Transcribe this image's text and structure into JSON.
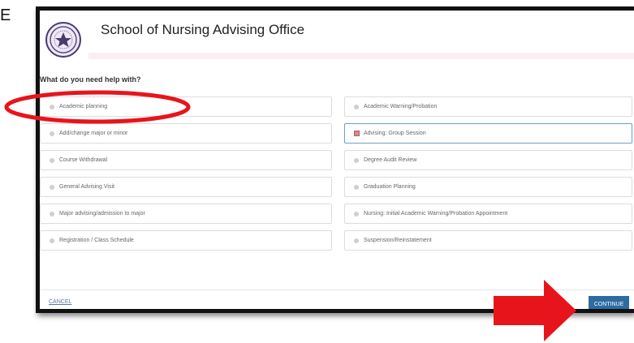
{
  "page": {
    "corner_glyph": "E",
    "title": "School of Nursing Advising Office",
    "question": "What do you need help with?"
  },
  "options": [
    {
      "label": "Academic planning",
      "control": "radio",
      "selected": false
    },
    {
      "label": "Academic Warning/Probation",
      "control": "radio",
      "selected": false
    },
    {
      "label": "Add/change major or minor",
      "control": "radio",
      "selected": false
    },
    {
      "label": "Advising: Group Session",
      "control": "checkbox",
      "selected": true
    },
    {
      "label": "Course Withdrawal",
      "control": "radio",
      "selected": false
    },
    {
      "label": "Degree Audit Review",
      "control": "radio",
      "selected": false
    },
    {
      "label": "General Advising Visit",
      "control": "radio",
      "selected": false
    },
    {
      "label": "Graduation Planning",
      "control": "radio",
      "selected": false
    },
    {
      "label": "Major advising/admission to major",
      "control": "radio",
      "selected": false
    },
    {
      "label": "Nursing: Initial Academic Warning/Probation Appointment",
      "control": "radio",
      "selected": false
    },
    {
      "label": "Registration / Class Schedule",
      "control": "radio",
      "selected": false
    },
    {
      "label": "Suspension/Reinstatement",
      "control": "radio",
      "selected": false
    }
  ],
  "footer": {
    "cancel_label": "CANCEL",
    "continue_label": "CONTINUE"
  },
  "colors": {
    "annotation_red": "#e8141b",
    "continue_blue": "#2d6ba0",
    "header_band": "#fbeef4",
    "selected_border": "#6d9ecf"
  },
  "icons": {
    "logo": "university-seal-icon",
    "annotation_arrow": "red-right-arrow-icon",
    "annotation_ellipse": "red-ellipse-highlight"
  }
}
